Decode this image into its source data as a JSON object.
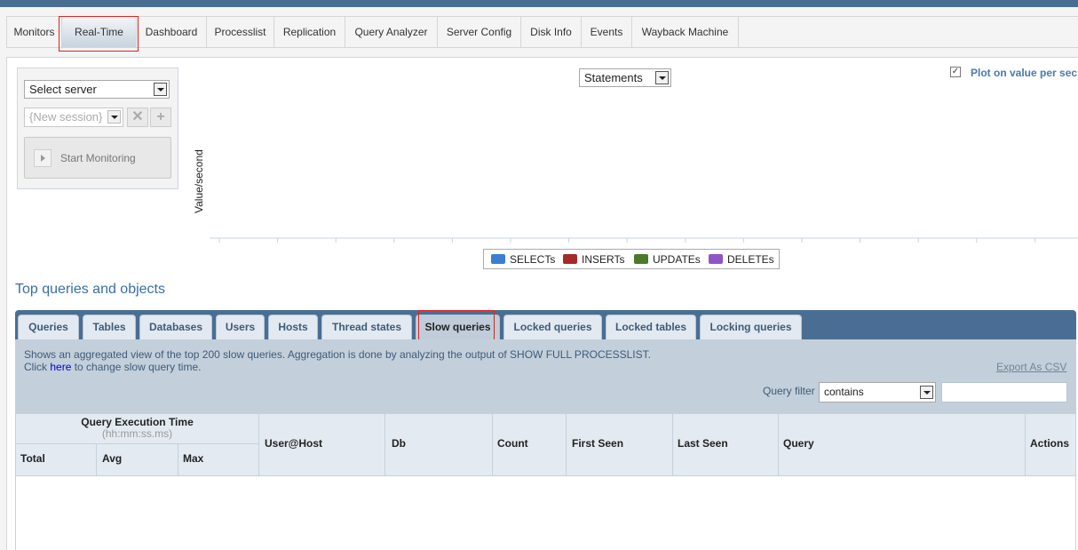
{
  "nav": {
    "tabs": [
      "Monitors",
      "Real-Time",
      "Dashboard",
      "Processlist",
      "Replication",
      "Query Analyzer",
      "Server Config",
      "Disk Info",
      "Events",
      "Wayback Machine"
    ],
    "active": "Real-Time"
  },
  "controls": {
    "server_select": "Select server",
    "session_select": "{New session}",
    "remove_icon": "✕",
    "add_icon": "+",
    "start_button": "Start Monitoring",
    "statements_select": "Statements",
    "plot_checkbox_mark": "✓",
    "plot_checkbox_label": "Plot on value per sec"
  },
  "chart_data": {
    "type": "line",
    "ylabel": "Value/second",
    "series": [
      {
        "name": "SELECTs",
        "color": "#3c7fd0",
        "values": []
      },
      {
        "name": "INSERTs",
        "color": "#a62a2a",
        "values": []
      },
      {
        "name": "UPDATEs",
        "color": "#4c7a2c",
        "values": []
      },
      {
        "name": "DELETEs",
        "color": "#8f55c6",
        "values": []
      }
    ]
  },
  "section": {
    "title": "Top queries and objects",
    "tabs": [
      "Queries",
      "Tables",
      "Databases",
      "Users",
      "Hosts",
      "Thread states",
      "Slow queries",
      "Locked queries",
      "Locked tables",
      "Locking queries"
    ],
    "active_tab": "Slow queries",
    "description_line1": "Shows an aggregated view of the top 200 slow queries. Aggregation is done by analyzing the output of SHOW FULL PROCESSLIST.",
    "description_line2_prefix": "Click ",
    "description_link": "here",
    "description_line2_suffix": " to change slow query time.",
    "export_link": "Export As CSV",
    "query_filter_label": "Query filter",
    "query_filter_mode": "contains"
  },
  "table": {
    "group_header": "Query Execution Time",
    "group_subheader": "(hh:mm:ss.ms)",
    "sub_columns": [
      "Total",
      "Avg",
      "Max"
    ],
    "columns": [
      "User@Host",
      "Db",
      "Count",
      "First Seen",
      "Last Seen",
      "Query",
      "Actions"
    ],
    "rows": []
  }
}
